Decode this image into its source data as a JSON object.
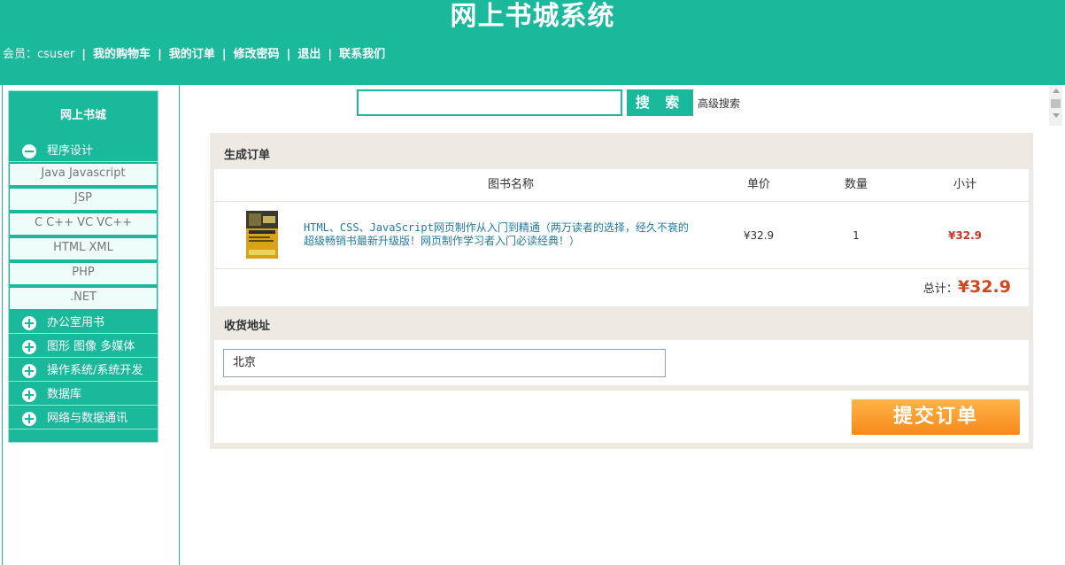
{
  "header": {
    "title": "网上书城系统",
    "member_label": "会员：",
    "username": "csuser",
    "nav_links": [
      "我的购物车",
      "我的订单",
      "修改密码",
      "退出",
      "联系我们"
    ],
    "separator": "|"
  },
  "sidebar": {
    "heading": "网上书城",
    "categories": [
      {
        "label": "程序设计",
        "expanded": true,
        "icon": "minus-circle-icon",
        "items": [
          "Java Javascript",
          "JSP",
          "C C++ VC VC++",
          "HTML XML",
          "PHP",
          ".NET"
        ]
      },
      {
        "label": "办公室用书",
        "expanded": false,
        "icon": "plus-circle-icon"
      },
      {
        "label": "图形 图像 多媒体",
        "expanded": false,
        "icon": "plus-circle-icon"
      },
      {
        "label": "操作系统/系统开发",
        "expanded": false,
        "icon": "plus-circle-icon"
      },
      {
        "label": "数据库",
        "expanded": false,
        "icon": "plus-circle-icon"
      },
      {
        "label": "网络与数据通讯",
        "expanded": false,
        "icon": "plus-circle-icon"
      }
    ]
  },
  "search": {
    "value": "",
    "button_label": "搜 索",
    "advanced_label": "高级搜索"
  },
  "order": {
    "title": "生成订单",
    "columns": [
      "图书名称",
      "单价",
      "数量",
      "小计"
    ],
    "items": [
      {
        "name": "HTML、CSS、JavaScript网页制作从入门到精通（两万读者的选择，经久不衰的超级畅销书最新升级版！网页制作学习者入门必读经典！）",
        "price": "¥32.9",
        "quantity": "1",
        "subtotal": "¥32.9"
      }
    ],
    "total_label": "总计：",
    "total_value": "¥32.9"
  },
  "address": {
    "title": "收货地址",
    "value": "北京"
  },
  "submit_label": "提交订单",
  "colors": {
    "brand": "#1ab99c",
    "price_red": "#d3461f",
    "submit_orange": "#f7891a"
  }
}
